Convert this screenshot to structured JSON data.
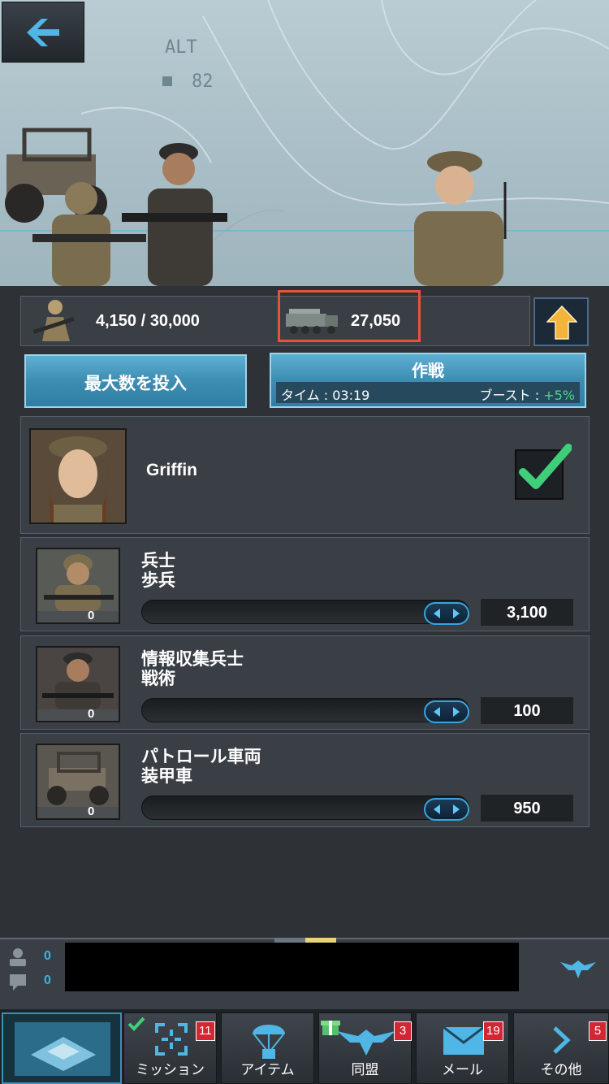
{
  "map": {
    "alt_label": "ALT",
    "alt_value": "82"
  },
  "resources": {
    "troops": "4,150 / 30,000",
    "vehicles": "27,050"
  },
  "actions": {
    "max_button": "最大数を投入",
    "operation_title": "作戦",
    "time_label": "タイム : 03:19",
    "boost_label": "ブースト : ",
    "boost_value": "+5%"
  },
  "commander": {
    "name": "Griffin",
    "selected": true
  },
  "troops": [
    {
      "name": "兵士",
      "type": "歩兵",
      "count": "0",
      "quantity": "3,100"
    },
    {
      "name": "情報収集兵士",
      "type": "戦術",
      "count": "0",
      "quantity": "100"
    },
    {
      "name": "パトロール車両",
      "type": "装甲車",
      "count": "0",
      "quantity": "950"
    }
  ],
  "chat": {
    "members": "0",
    "messages": "0"
  },
  "nav": [
    {
      "label": "",
      "icon": "base-icon"
    },
    {
      "label": "ミッション",
      "badge": "11",
      "icon": "crosshair-icon"
    },
    {
      "label": "アイテム",
      "icon": "parachute-icon"
    },
    {
      "label": "同盟",
      "badge": "3",
      "icon": "eagle-icon"
    },
    {
      "label": "メール",
      "badge": "19",
      "icon": "mail-icon"
    },
    {
      "label": "その他",
      "badge": "5",
      "icon": "chevron-right-icon"
    }
  ],
  "colors": {
    "accent": "#3fb1e5",
    "highlight": "#e5533d",
    "boost": "#4cd48a",
    "badge": "#d32532",
    "check": "#3fcf7a"
  }
}
